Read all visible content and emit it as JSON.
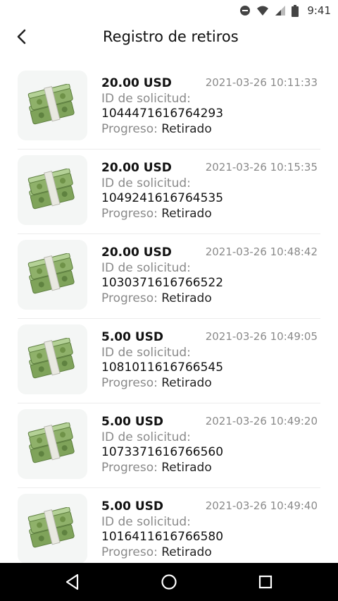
{
  "status_bar": {
    "time": "9:41"
  },
  "header": {
    "title": "Registro de retiros"
  },
  "withdrawals": [
    {
      "amount": "20.00 USD",
      "date": "2021-03-26 10:11:33",
      "request_label": "ID de solicitud:",
      "request_id": "1044471616764293",
      "progress_label": "Progreso:",
      "progress_value": "Retirado"
    },
    {
      "amount": "20.00 USD",
      "date": "2021-03-26 10:15:35",
      "request_label": "ID de solicitud:",
      "request_id": "1049241616764535",
      "progress_label": "Progreso:",
      "progress_value": "Retirado"
    },
    {
      "amount": "20.00 USD",
      "date": "2021-03-26 10:48:42",
      "request_label": "ID de solicitud:",
      "request_id": "1030371616766522",
      "progress_label": "Progreso:",
      "progress_value": "Retirado"
    },
    {
      "amount": "5.00 USD",
      "date": "2021-03-26 10:49:05",
      "request_label": "ID de solicitud:",
      "request_id": "1081011616766545",
      "progress_label": "Progreso:",
      "progress_value": "Retirado"
    },
    {
      "amount": "5.00 USD",
      "date": "2021-03-26 10:49:20",
      "request_label": "ID de solicitud:",
      "request_id": "1073371616766560",
      "progress_label": "Progreso:",
      "progress_value": "Retirado"
    },
    {
      "amount": "5.00 USD",
      "date": "2021-03-26 10:49:40",
      "request_label": "ID de solicitud:",
      "request_id": "1016411616766580",
      "progress_label": "Progreso:",
      "progress_value": "Retirado"
    }
  ],
  "icons": {
    "status": [
      "do-not-disturb-icon",
      "wifi-icon",
      "signal-icon",
      "battery-icon"
    ],
    "thumbnail": "money-stack-icon",
    "nav": [
      "nav-back-icon",
      "nav-home-icon",
      "nav-recent-apps-icon"
    ]
  },
  "colors": {
    "money_green": "#8fb16a",
    "band": "#e8e8e0",
    "secondary_text": "#8a8a8a",
    "nav_bar": "#000000"
  }
}
